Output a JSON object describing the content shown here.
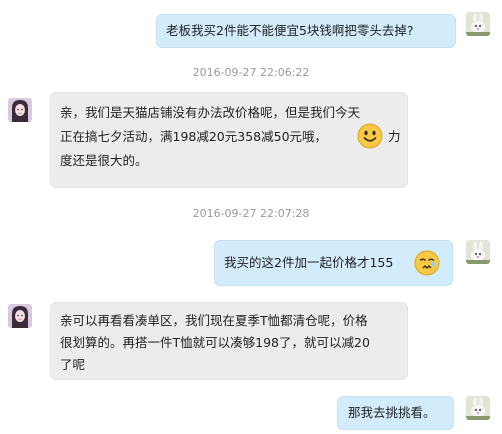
{
  "messages": [
    {
      "side": "right",
      "text": "老板我买2件能不能便宜5块钱啊把零头去掉?"
    },
    {
      "timestamp": "2016-09-27 22:06:22"
    },
    {
      "side": "left",
      "lines": [
        "亲，我们是天猫店铺没有办法改价格呢，但是我们今天",
        "正在搞七夕活动，满198减20元358减50元哦，",
        "力",
        "度还是很大的。"
      ],
      "emoji": "smile-emoji"
    },
    {
      "timestamp": "2016-09-27 22:07:28"
    },
    {
      "side": "right",
      "text": "我买的这2件加一起价格才155",
      "emoji": "sad-emoji"
    },
    {
      "side": "left",
      "lines": [
        "亲可以再看看凑单区，我们现在夏季T恤都清仓呢，价格",
        "很划算的。再搭一件T恤就可以凑够198了，就可以减20",
        "了呢"
      ]
    },
    {
      "side": "right",
      "text": "那我去挑挑看。"
    }
  ],
  "colors": {
    "outgoing_bubble": "#d3ecfb",
    "incoming_bubble": "#ececec",
    "timestamp": "#9a9a9a"
  }
}
